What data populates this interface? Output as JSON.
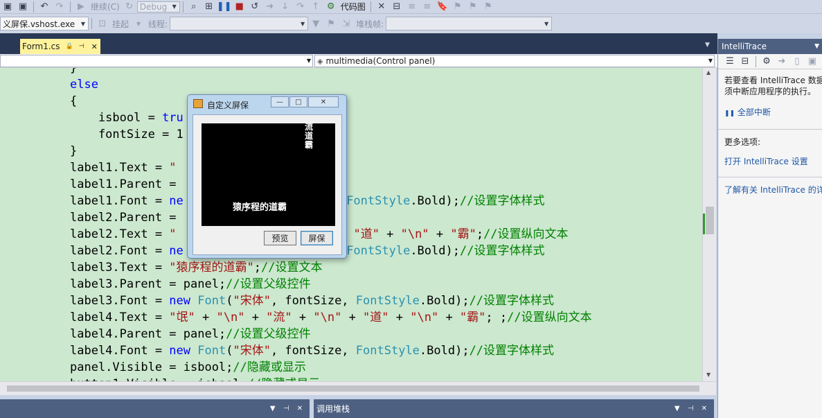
{
  "toolbar": {
    "continue_label": "继续(C)",
    "config_value": "Debug",
    "codemap_label": "代码图",
    "process_value": "义屏保.vshost.exe",
    "suspend_label": "挂起",
    "thread_label": "线程:",
    "stackframe_label": "堆栈帧:"
  },
  "editor": {
    "tab_title": "Form1.cs",
    "member_dropdown": "multimedia(Control panel)"
  },
  "code_lines": [
    [
      {
        "t": "}"
      }
    ],
    [
      {
        "t": "else",
        "c": "kw"
      }
    ],
    [
      {
        "t": "{"
      }
    ],
    [
      {
        "t": "    isbool = "
      },
      {
        "t": "tru",
        "c": "kw"
      }
    ],
    [
      {
        "t": "    fontSize = 1"
      }
    ],
    [
      {
        "t": "}"
      }
    ],
    [
      {
        "t": "label1.Text = "
      },
      {
        "t": "\"",
        "c": "st"
      }
    ],
    [
      {
        "t": "label1.Parent ="
      }
    ],
    [
      {
        "t": "label1.Font = "
      },
      {
        "t": "ne",
        "c": "kw"
      },
      {
        "t": "                   ze, "
      },
      {
        "t": "FontStyle",
        "c": "ty"
      },
      {
        "t": ".Bold);"
      },
      {
        "t": "//设置字体样式",
        "c": "cm"
      }
    ],
    [
      {
        "t": "label2.Parent ="
      }
    ],
    [
      {
        "t": "label2.Text = "
      },
      {
        "t": "\"",
        "c": "st"
      },
      {
        "t": "                   "
      },
      {
        "t": "\\n\"",
        "c": "st"
      },
      {
        "t": " + "
      },
      {
        "t": "\"道\"",
        "c": "st"
      },
      {
        "t": " + "
      },
      {
        "t": "\"\\n\"",
        "c": "st"
      },
      {
        "t": " + "
      },
      {
        "t": "\"霸\"",
        "c": "st"
      },
      {
        "t": ";"
      },
      {
        "t": "//设置纵向文本",
        "c": "cm"
      }
    ],
    [
      {
        "t": "label2.Font = "
      },
      {
        "t": "ne",
        "c": "kw"
      },
      {
        "t": "                   ze, "
      },
      {
        "t": "FontStyle",
        "c": "ty"
      },
      {
        "t": ".Bold);"
      },
      {
        "t": "//设置字体样式",
        "c": "cm"
      }
    ],
    [
      {
        "t": "label3.Text = "
      },
      {
        "t": "\"猿序程的道霸\"",
        "c": "st"
      },
      {
        "t": ";"
      },
      {
        "t": "//设置文本",
        "c": "cm"
      }
    ],
    [
      {
        "t": "label3.Parent = panel;"
      },
      {
        "t": "//设置父级控件",
        "c": "cm"
      }
    ],
    [
      {
        "t": "label3.Font = "
      },
      {
        "t": "new",
        "c": "kw"
      },
      {
        "t": " "
      },
      {
        "t": "Font",
        "c": "ty"
      },
      {
        "t": "("
      },
      {
        "t": "\"宋体\"",
        "c": "st"
      },
      {
        "t": ", fontSize, "
      },
      {
        "t": "FontStyle",
        "c": "ty"
      },
      {
        "t": ".Bold);"
      },
      {
        "t": "//设置字体样式",
        "c": "cm"
      }
    ],
    [
      {
        "t": "label4.Text = "
      },
      {
        "t": "\"氓\"",
        "c": "st"
      },
      {
        "t": " + "
      },
      {
        "t": "\"\\n\"",
        "c": "st"
      },
      {
        "t": " + "
      },
      {
        "t": "\"流\"",
        "c": "st"
      },
      {
        "t": " + "
      },
      {
        "t": "\"\\n\"",
        "c": "st"
      },
      {
        "t": " + "
      },
      {
        "t": "\"道\"",
        "c": "st"
      },
      {
        "t": " + "
      },
      {
        "t": "\"\\n\"",
        "c": "st"
      },
      {
        "t": " + "
      },
      {
        "t": "\"霸\"",
        "c": "st"
      },
      {
        "t": "; ;"
      },
      {
        "t": "//设置纵向文本",
        "c": "cm"
      }
    ],
    [
      {
        "t": "label4.Parent = panel;"
      },
      {
        "t": "//设置父级控件",
        "c": "cm"
      }
    ],
    [
      {
        "t": "label4.Font = "
      },
      {
        "t": "new",
        "c": "kw"
      },
      {
        "t": " "
      },
      {
        "t": "Font",
        "c": "ty"
      },
      {
        "t": "("
      },
      {
        "t": "\"宋体\"",
        "c": "st"
      },
      {
        "t": ", fontSize, "
      },
      {
        "t": "FontStyle",
        "c": "ty"
      },
      {
        "t": ".Bold);"
      },
      {
        "t": "//设置字体样式",
        "c": "cm"
      }
    ],
    [
      {
        "t": "panel.Visible = isbool;"
      },
      {
        "t": "//隐藏或显示",
        "c": "cm"
      }
    ],
    [
      {
        "t": "button1.Visible = isbool;"
      },
      {
        "t": "//隐藏或显示",
        "c": "cm"
      }
    ]
  ],
  "dialog": {
    "title": "自定义屏保",
    "vertical_text": "流\n道\n霸",
    "panel_text": "猿序程的道霸",
    "preview_label": "预览",
    "screensaver_label": "屏保"
  },
  "intellitrace": {
    "title": "IntelliTrace",
    "message_line1": "若要查看 IntelliTrace 数据",
    "message_line2": "须中断应用程序的执行。",
    "break_all": "全部中断",
    "more_options": "更多选项:",
    "open_settings": "打开 IntelliTrace 设置",
    "learn_more": "了解有关 IntelliTrace 的详"
  },
  "bottom": {
    "callstack_title": "调用堆栈"
  }
}
